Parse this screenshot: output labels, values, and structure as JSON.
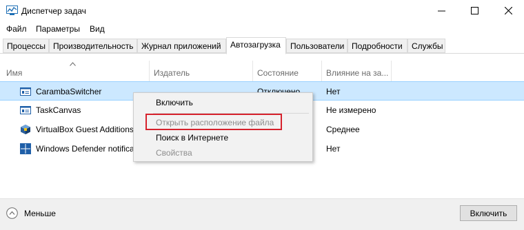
{
  "window": {
    "title": "Диспетчер задач"
  },
  "menu": [
    "Файл",
    "Параметры",
    "Вид"
  ],
  "tabs": [
    {
      "label": "Процессы",
      "active": false
    },
    {
      "label": "Производительность",
      "active": false
    },
    {
      "label": "Журнал приложений",
      "active": false
    },
    {
      "label": "Автозагрузка",
      "active": true
    },
    {
      "label": "Пользователи",
      "active": false
    },
    {
      "label": "Подробности",
      "active": false
    },
    {
      "label": "Службы",
      "active": false
    }
  ],
  "columns": {
    "name": "Имя",
    "publisher": "Издатель",
    "state": "Состояние",
    "impact": "Влияние на за..."
  },
  "rows": [
    {
      "name": "CarambaSwitcher",
      "icon": "app-window-icon",
      "state": "Отключено",
      "impact": "Нет",
      "selected": true
    },
    {
      "name": "TaskCanvas",
      "icon": "app-window-icon",
      "state": "",
      "impact": "Не измерено",
      "selected": false
    },
    {
      "name": "VirtualBox Guest Additions",
      "icon": "virtualbox-icon",
      "state": "",
      "impact": "Среднее",
      "selected": false
    },
    {
      "name": "Windows Defender notificati",
      "icon": "windows-defender-icon",
      "state": "",
      "impact": "Нет",
      "selected": false
    }
  ],
  "context_menu": {
    "items": [
      {
        "label": "Включить",
        "disabled": false
      },
      {
        "label": "Открыть расположение файла",
        "disabled": true,
        "highlighted": true
      },
      {
        "label": "Поиск в Интернете",
        "disabled": false
      },
      {
        "label": "Свойства",
        "disabled": true
      }
    ]
  },
  "footer": {
    "less_label": "Меньше",
    "enable_button": "Включить"
  },
  "colors": {
    "selection_bg": "#cce8ff",
    "highlight_border": "#d6212c"
  }
}
